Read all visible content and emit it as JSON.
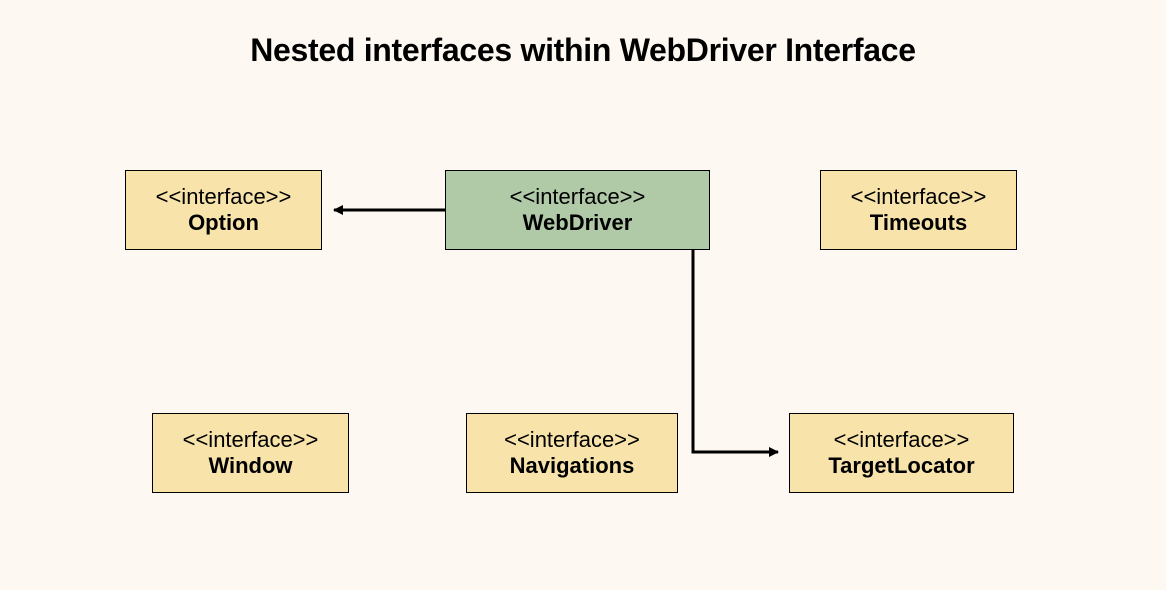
{
  "title": "Nested interfaces within WebDriver Interface",
  "stereotype": "<<interface>>",
  "boxes": {
    "option": {
      "name": "Option"
    },
    "webdriver": {
      "name": "WebDriver"
    },
    "timeouts": {
      "name": "Timeouts"
    },
    "window": {
      "name": "Window"
    },
    "navigations": {
      "name": "Navigations"
    },
    "targetlocator": {
      "name": "TargetLocator"
    }
  },
  "colors": {
    "background": "#fdf9f2",
    "cream": "#f8e4ab",
    "green": "#b0c9a6",
    "arrow": "#000000"
  }
}
